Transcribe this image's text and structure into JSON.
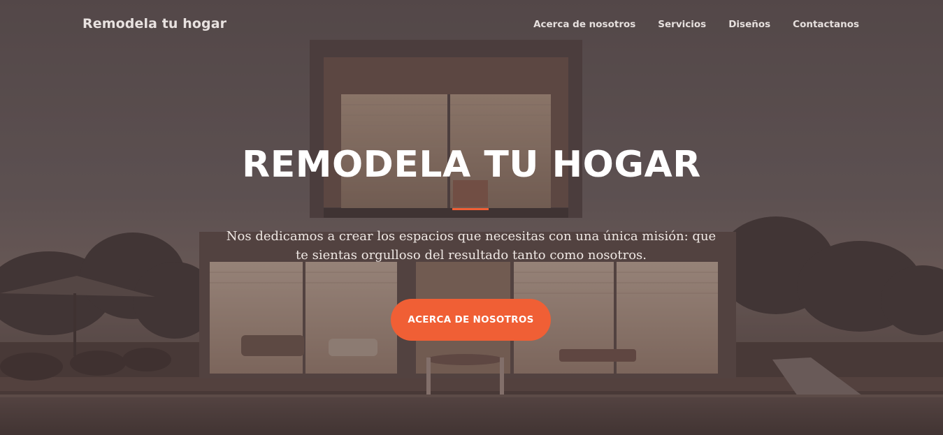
{
  "navbar": {
    "brand": "Remodela tu hogar",
    "links": [
      {
        "label": "Acerca de nosotros"
      },
      {
        "label": "Servicios"
      },
      {
        "label": "Diseños"
      },
      {
        "label": "Contactanos"
      }
    ]
  },
  "hero": {
    "title": "REMODELA TU HOGAR",
    "text": "Nos dedicamos a crear los espacios que necesitas con una única misión: que te sientas orgulloso del resultado tanto como nosotros.",
    "cta_label": "ACERCA DE NOSOTROS"
  },
  "colors": {
    "accent": "#f05f35",
    "overlay": "#463836"
  }
}
